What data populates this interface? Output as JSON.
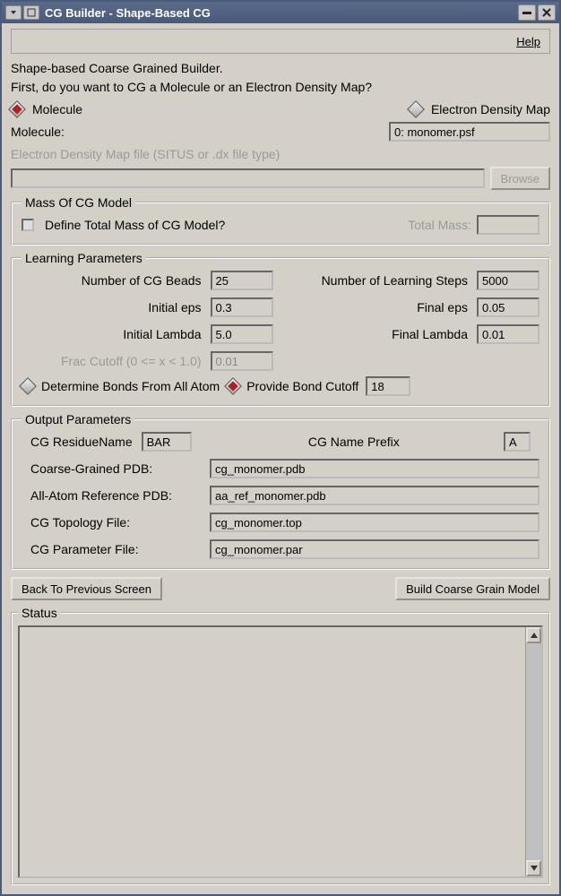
{
  "window": {
    "title": "CG Builder - Shape-Based CG"
  },
  "toolbar": {
    "help_label": "Help"
  },
  "intro": {
    "line1": "Shape-based Coarse Grained Builder.",
    "line2": "First, do you want to CG a Molecule or an Electron Density Map?"
  },
  "source_choice": {
    "molecule_label": "Molecule",
    "edm_label": "Electron Density Map",
    "selected": "molecule"
  },
  "molecule": {
    "label": "Molecule:",
    "value": "0: monomer.psf"
  },
  "edm_file": {
    "label": "Electron Density Map file (SITUS or .dx file type)",
    "value": "",
    "browse_label": "Browse"
  },
  "mass": {
    "legend": "Mass Of CG Model",
    "define_label": "Define Total Mass of CG Model?",
    "define_checked": false,
    "total_mass_label": "Total Mass:",
    "total_mass_value": ""
  },
  "learning": {
    "legend": "Learning Parameters",
    "num_beads_label": "Number of CG Beads",
    "num_beads": "25",
    "num_steps_label": "Number of Learning Steps",
    "num_steps": "5000",
    "initial_eps_label": "Initial eps",
    "initial_eps": "0.3",
    "final_eps_label": "Final eps",
    "final_eps": "0.05",
    "initial_lambda_label": "Initial Lambda",
    "initial_lambda": "5.0",
    "final_lambda_label": "Final Lambda",
    "final_lambda": "0.01",
    "frac_cutoff_label": "Frac Cutoff (0 <= x < 1.0)",
    "frac_cutoff": "0.01",
    "bonds_allatom_label": "Determine Bonds From All Atom",
    "bonds_cutoff_label": "Provide Bond Cutoff",
    "bond_cutoff_value": "18",
    "bond_mode": "cutoff"
  },
  "output": {
    "legend": "Output Parameters",
    "residue_name_label": "CG ResidueName",
    "residue_name": "BAR",
    "name_prefix_label": "CG Name Prefix",
    "name_prefix": "A",
    "cg_pdb_label": "Coarse-Grained PDB:",
    "cg_pdb": "cg_monomer.pdb",
    "aa_ref_label": "All-Atom Reference PDB:",
    "aa_ref": "aa_ref_monomer.pdb",
    "cg_top_label": "CG Topology File:",
    "cg_top": "cg_monomer.top",
    "cg_par_label": "CG Parameter File:",
    "cg_par": "cg_monomer.par"
  },
  "actions": {
    "back_label": "Back To Previous Screen",
    "build_label": "Build Coarse Grain Model"
  },
  "status": {
    "legend": "Status",
    "text": ""
  }
}
